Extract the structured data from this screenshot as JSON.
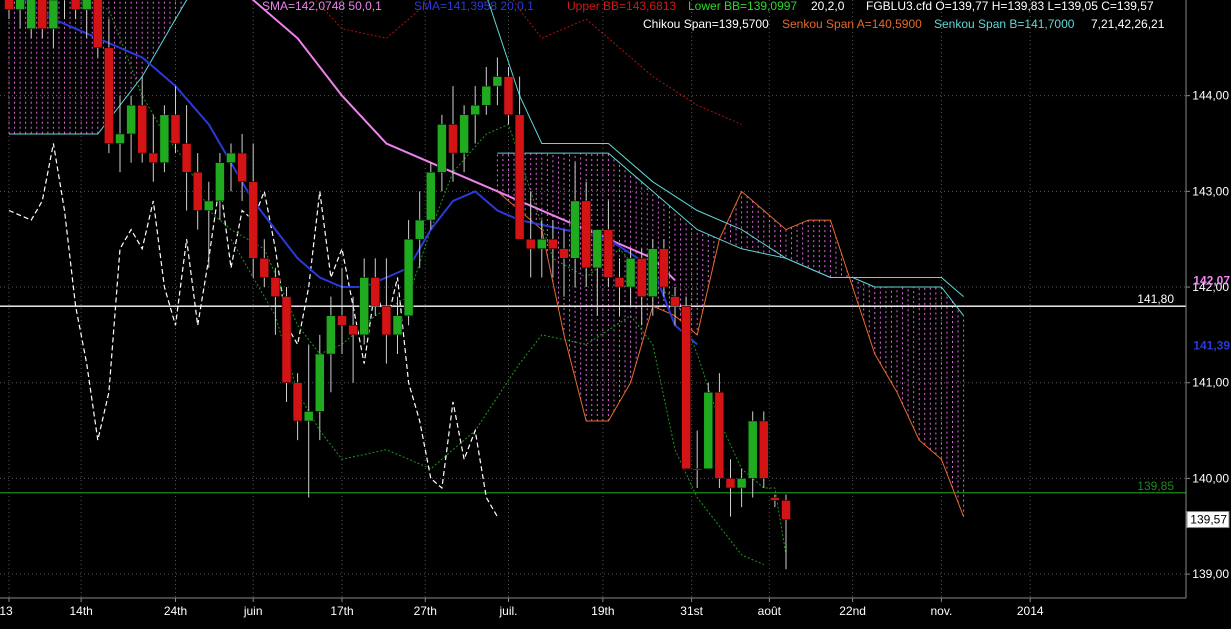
{
  "chart_data": {
    "type": "candlestick",
    "symbol": "FGBLU3.cfd",
    "ohlc_line": {
      "o": "O=139,77",
      "h": "H=139,83",
      "l": "L=139,05",
      "c": "C=139,57"
    },
    "indicators_top": {
      "sma_magenta": "SMA=142,0748  50,0,1",
      "sma_blue": "SMA=141,3958  20,0,1",
      "upper_bb": "Upper BB=143,6813",
      "lower_bb": "Lower BB=139,0997",
      "bb_params": "20,2,0",
      "chikou": "Chikou Span=139,5700",
      "senkou_a": "Senkou Span A=140,5900",
      "senkou_b": "Senkou Span B=141,7000",
      "ichimoku_params": "7,21,42,26,21"
    },
    "ylim": [
      138.75,
      145.0
    ],
    "y_ticks": [
      {
        "v": 139.0,
        "label": "139,00"
      },
      {
        "v": 140.0,
        "label": "140,00"
      },
      {
        "v": 141.0,
        "label": "141,00"
      },
      {
        "v": 142.0,
        "label": "142,00"
      },
      {
        "v": 143.0,
        "label": "143,00"
      },
      {
        "v": 144.0,
        "label": "144,00"
      }
    ],
    "x_ticks": [
      "13",
      "14th",
      "24th",
      "juin",
      "17th",
      "27th",
      "juil.",
      "19th",
      "31st",
      "août",
      "22nd",
      "nov.",
      "2014"
    ],
    "x_tick_bar": [
      0,
      6.5,
      15,
      22,
      30,
      37.5,
      45,
      53.5,
      61.5,
      68.5,
      76,
      84,
      92
    ],
    "horizontal_lines": [
      {
        "v": 141.8,
        "label": "141,80",
        "color": "#ffffff"
      },
      {
        "v": 139.85,
        "label": "139,85",
        "color": "#1a8a1a"
      }
    ],
    "right_value_labels": [
      {
        "v": 142.07,
        "label": "142,07",
        "color": "#ee82ee"
      },
      {
        "v": 141.39,
        "label": "141,39",
        "color": "#2a3ad8"
      }
    ],
    "last_price": {
      "v": 139.57,
      "label": "139,57"
    },
    "candles": [
      [
        145.4,
        145.6,
        144.8,
        144.9
      ],
      [
        144.9,
        145.4,
        144.7,
        145.1
      ],
      [
        144.7,
        145.3,
        144.6,
        145.2
      ],
      [
        145.2,
        145.4,
        144.6,
        144.7
      ],
      [
        144.7,
        145.2,
        144.5,
        145.0
      ],
      [
        145.0,
        145.3,
        144.8,
        145.2
      ],
      [
        145.3,
        145.5,
        144.8,
        144.9
      ],
      [
        144.9,
        145.2,
        144.6,
        145.1
      ],
      [
        145.1,
        145.3,
        144.4,
        144.5
      ],
      [
        144.5,
        144.8,
        143.4,
        143.5
      ],
      [
        143.5,
        144.0,
        143.2,
        143.6
      ],
      [
        143.6,
        144.0,
        143.3,
        143.9
      ],
      [
        143.9,
        144.2,
        143.3,
        143.4
      ],
      [
        143.4,
        143.8,
        143.1,
        143.3
      ],
      [
        143.3,
        143.9,
        143.2,
        143.8
      ],
      [
        143.8,
        144.1,
        143.4,
        143.5
      ],
      [
        143.5,
        143.9,
        142.8,
        143.2
      ],
      [
        143.2,
        143.4,
        142.6,
        142.8
      ],
      [
        142.8,
        143.1,
        142.2,
        142.9
      ],
      [
        142.9,
        143.4,
        142.7,
        143.3
      ],
      [
        143.3,
        143.5,
        143.0,
        143.4
      ],
      [
        143.4,
        143.6,
        142.9,
        143.1
      ],
      [
        143.1,
        143.5,
        142.1,
        142.3
      ],
      [
        142.3,
        142.5,
        142.0,
        142.1
      ],
      [
        142.1,
        142.2,
        141.5,
        141.9
      ],
      [
        141.9,
        142.0,
        140.8,
        141.0
      ],
      [
        141.0,
        141.1,
        140.4,
        140.6
      ],
      [
        140.6,
        141.4,
        139.8,
        140.7
      ],
      [
        140.7,
        141.5,
        140.4,
        141.3
      ],
      [
        141.3,
        141.9,
        140.9,
        141.7
      ],
      [
        141.7,
        142.2,
        141.3,
        141.6
      ],
      [
        141.6,
        141.9,
        141.0,
        141.5
      ],
      [
        141.5,
        142.3,
        141.4,
        142.1
      ],
      [
        142.1,
        142.3,
        141.7,
        141.8
      ],
      [
        141.8,
        142.3,
        141.2,
        141.5
      ],
      [
        141.5,
        141.9,
        141.3,
        141.7
      ],
      [
        141.7,
        142.7,
        141.6,
        142.5
      ],
      [
        142.5,
        143.0,
        142.2,
        142.7
      ],
      [
        142.7,
        143.3,
        142.6,
        143.2
      ],
      [
        143.2,
        143.8,
        143.0,
        143.7
      ],
      [
        143.7,
        144.1,
        143.1,
        143.4
      ],
      [
        143.4,
        143.9,
        143.2,
        143.8
      ],
      [
        143.8,
        144.1,
        143.5,
        143.9
      ],
      [
        143.9,
        144.3,
        143.8,
        144.1
      ],
      [
        144.1,
        144.4,
        143.9,
        144.2
      ],
      [
        144.2,
        144.3,
        143.7,
        143.8
      ],
      [
        143.8,
        144.2,
        143.1,
        142.5
      ],
      [
        142.5,
        143.0,
        142.1,
        142.4
      ],
      [
        142.4,
        142.7,
        142.1,
        142.5
      ],
      [
        142.5,
        142.7,
        142.1,
        142.4
      ],
      [
        142.4,
        142.6,
        141.9,
        142.3
      ],
      [
        142.3,
        143.3,
        142.0,
        142.9
      ],
      [
        142.9,
        143.1,
        142.0,
        142.2
      ],
      [
        142.2,
        142.5,
        141.7,
        142.6
      ],
      [
        142.6,
        142.9,
        142.0,
        142.1
      ],
      [
        142.1,
        142.3,
        141.7,
        142.0
      ],
      [
        142.0,
        142.4,
        141.8,
        142.3
      ],
      [
        142.3,
        142.4,
        141.6,
        141.9
      ],
      [
        141.9,
        142.5,
        141.7,
        142.4
      ],
      [
        142.4,
        142.5,
        141.9,
        142.0
      ],
      [
        141.9,
        142.0,
        141.6,
        141.8
      ],
      [
        141.8,
        141.9,
        140.3,
        140.1
      ],
      [
        140.1,
        140.5,
        139.9,
        140.1
      ],
      [
        140.1,
        141.0,
        140.5,
        140.9
      ],
      [
        140.9,
        141.1,
        139.9,
        140.0
      ],
      [
        140.0,
        140.2,
        139.6,
        139.9
      ],
      [
        139.9,
        140.1,
        139.7,
        140.0
      ],
      [
        140.0,
        140.7,
        139.8,
        140.6
      ],
      [
        140.6,
        140.7,
        139.9,
        140.0
      ],
      [
        139.8,
        139.83,
        139.7,
        139.77
      ],
      [
        139.77,
        139.83,
        139.05,
        139.57
      ]
    ],
    "tenkan": [
      [
        0,
        145.3
      ],
      [
        9,
        144.9
      ],
      [
        12,
        144.0
      ],
      [
        14,
        143.6
      ],
      [
        16,
        143.3
      ],
      [
        18,
        142.8
      ],
      [
        20,
        142.6
      ],
      [
        23,
        142.4
      ],
      [
        26,
        141.6
      ],
      [
        28,
        141.3
      ],
      [
        30,
        141.4
      ],
      [
        33,
        141.7
      ],
      [
        36,
        141.9
      ],
      [
        38,
        142.6
      ],
      [
        40,
        143.2
      ],
      [
        43,
        143.6
      ],
      [
        45,
        143.7
      ],
      [
        47,
        143.0
      ],
      [
        49,
        142.3
      ],
      [
        52,
        142.1
      ],
      [
        55,
        142.4
      ],
      [
        58,
        142.0
      ],
      [
        60,
        141.9
      ],
      [
        62,
        141.3
      ],
      [
        64,
        140.6
      ],
      [
        66,
        140.1
      ],
      [
        68,
        139.9
      ],
      [
        69,
        139.9
      ],
      [
        70,
        139.2
      ]
    ],
    "kijun": [
      [
        0,
        143.6
      ],
      [
        4,
        143.6
      ],
      [
        8,
        143.6
      ],
      [
        12,
        144.2
      ],
      [
        16,
        145.0
      ],
      [
        20,
        145.4
      ],
      [
        26,
        145.4
      ],
      [
        30,
        145.4
      ],
      [
        36,
        145.4
      ],
      [
        42,
        145.4
      ],
      [
        46,
        144.0
      ],
      [
        48,
        143.5
      ],
      [
        54,
        143.5
      ],
      [
        58,
        143.1
      ],
      [
        62,
        142.8
      ],
      [
        66,
        142.6
      ],
      [
        70,
        142.3
      ],
      [
        74,
        142.1
      ],
      [
        80,
        142.1
      ],
      [
        84,
        142.1
      ],
      [
        86,
        141.9
      ]
    ],
    "senkou_a": [
      [
        44,
        143.0
      ],
      [
        48,
        142.6
      ],
      [
        50,
        141.5
      ],
      [
        52,
        140.6
      ],
      [
        54,
        140.6
      ],
      [
        56,
        141.0
      ],
      [
        58,
        141.8
      ],
      [
        60,
        141.7
      ],
      [
        62,
        141.5
      ],
      [
        64,
        142.5
      ],
      [
        66,
        143.0
      ],
      [
        68,
        142.8
      ],
      [
        70,
        142.6
      ],
      [
        72,
        142.7
      ],
      [
        74,
        142.7
      ],
      [
        76,
        142.0
      ],
      [
        78,
        141.3
      ],
      [
        80,
        140.9
      ],
      [
        82,
        140.4
      ],
      [
        84,
        140.2
      ],
      [
        86,
        139.6
      ]
    ],
    "senkou_b": [
      [
        44,
        143.4
      ],
      [
        50,
        143.4
      ],
      [
        54,
        143.4
      ],
      [
        58,
        143.0
      ],
      [
        62,
        142.6
      ],
      [
        66,
        142.4
      ],
      [
        70,
        142.3
      ],
      [
        74,
        142.1
      ],
      [
        76,
        142.1
      ],
      [
        78,
        142.0
      ],
      [
        80,
        142.0
      ],
      [
        82,
        142.0
      ],
      [
        84,
        142.0
      ],
      [
        86,
        141.7
      ]
    ],
    "chikou": [
      [
        0,
        142.8
      ],
      [
        2,
        142.7
      ],
      [
        3,
        142.9
      ],
      [
        4,
        143.5
      ],
      [
        5,
        142.8
      ],
      [
        6,
        141.8
      ],
      [
        7,
        141.2
      ],
      [
        8,
        140.4
      ],
      [
        9,
        140.9
      ],
      [
        10,
        142.4
      ],
      [
        11,
        142.6
      ],
      [
        12,
        142.4
      ],
      [
        13,
        142.9
      ],
      [
        14,
        142.0
      ],
      [
        15,
        141.6
      ],
      [
        16,
        142.5
      ],
      [
        17,
        141.6
      ],
      [
        18,
        142.3
      ],
      [
        19,
        143.1
      ],
      [
        20,
        142.2
      ],
      [
        21,
        142.8
      ],
      [
        22,
        142.7
      ],
      [
        23,
        143.0
      ],
      [
        24,
        142.4
      ],
      [
        25,
        141.6
      ],
      [
        26,
        141.4
      ],
      [
        27,
        142.0
      ],
      [
        28,
        143.0
      ],
      [
        29,
        142.1
      ],
      [
        30,
        142.4
      ],
      [
        31,
        141.8
      ],
      [
        32,
        141.2
      ],
      [
        33,
        142.0
      ],
      [
        34,
        141.6
      ],
      [
        35,
        142.1
      ],
      [
        36,
        141.0
      ],
      [
        37,
        140.6
      ],
      [
        38,
        140.0
      ],
      [
        39,
        139.9
      ],
      [
        40,
        140.8
      ],
      [
        41,
        140.2
      ],
      [
        42,
        140.5
      ],
      [
        43,
        139.8
      ],
      [
        44,
        139.6
      ]
    ],
    "upper_bb": [
      [
        20,
        145.4
      ],
      [
        26,
        145.2
      ],
      [
        30,
        144.7
      ],
      [
        34,
        144.6
      ],
      [
        38,
        145.0
      ],
      [
        42,
        145.6
      ],
      [
        46,
        144.9
      ],
      [
        48,
        144.6
      ],
      [
        52,
        144.8
      ],
      [
        54,
        144.6
      ],
      [
        58,
        144.2
      ],
      [
        62,
        143.9
      ],
      [
        64,
        143.8
      ],
      [
        66,
        143.7
      ]
    ],
    "lower_bb": [
      [
        20,
        142.5
      ],
      [
        24,
        141.7
      ],
      [
        26,
        140.9
      ],
      [
        28,
        140.5
      ],
      [
        30,
        140.2
      ],
      [
        34,
        140.3
      ],
      [
        38,
        140.1
      ],
      [
        42,
        140.5
      ],
      [
        46,
        141.2
      ],
      [
        48,
        141.5
      ],
      [
        52,
        141.4
      ],
      [
        56,
        141.7
      ],
      [
        58,
        141.4
      ],
      [
        60,
        140.3
      ],
      [
        62,
        139.8
      ],
      [
        64,
        139.5
      ],
      [
        66,
        139.2
      ],
      [
        68,
        139.1
      ]
    ],
    "sma_blue": [
      [
        0,
        145.1
      ],
      [
        4,
        144.8
      ],
      [
        8,
        144.6
      ],
      [
        12,
        144.4
      ],
      [
        15,
        144.1
      ],
      [
        18,
        143.7
      ],
      [
        20,
        143.3
      ],
      [
        22,
        142.9
      ],
      [
        26,
        142.3
      ],
      [
        28,
        142.1
      ],
      [
        30,
        142.0
      ],
      [
        32,
        142.0
      ],
      [
        34,
        142.1
      ],
      [
        36,
        142.2
      ],
      [
        38,
        142.6
      ],
      [
        40,
        142.9
      ],
      [
        42,
        143.0
      ],
      [
        44,
        142.8
      ],
      [
        46,
        142.7
      ],
      [
        50,
        142.6
      ],
      [
        54,
        142.5
      ],
      [
        58,
        142.2
      ],
      [
        60,
        141.6
      ],
      [
        62,
        141.4
      ]
    ],
    "sma_magenta": [
      [
        0,
        146.0
      ],
      [
        10,
        145.6
      ],
      [
        20,
        145.2
      ],
      [
        26,
        144.6
      ],
      [
        30,
        144.0
      ],
      [
        34,
        143.5
      ],
      [
        38,
        143.3
      ],
      [
        42,
        143.1
      ],
      [
        46,
        142.9
      ],
      [
        50,
        142.7
      ],
      [
        54,
        142.5
      ],
      [
        58,
        142.3
      ],
      [
        60,
        142.07
      ]
    ]
  }
}
